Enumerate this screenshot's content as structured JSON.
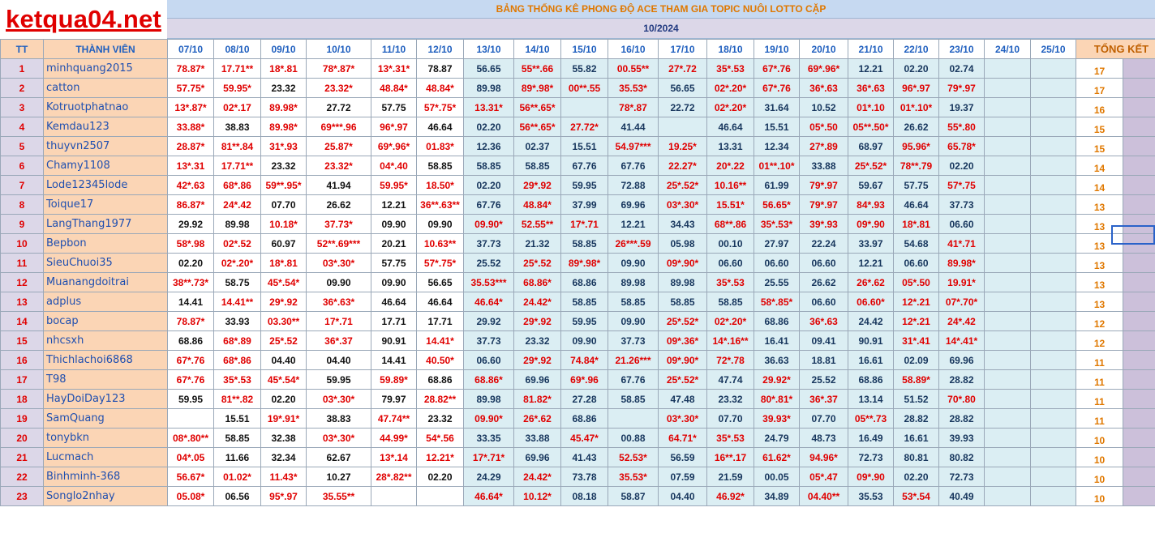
{
  "logo": "ketqua04.net",
  "title": "BẢNG THỐNG KÊ PHONG ĐỘ ACE THAM GIA TOPIC NUÔI LOTTO CẶP",
  "month": "10/2024",
  "colors": {
    "red": "#e00000",
    "header_blue": "#c6d9f1",
    "name_bg": "#fbd5b5",
    "row_num_bg": "#dcd7e8",
    "light_blue": "#dbeef3",
    "summary_orange": "#e07800"
  },
  "headers": {
    "tt": "TT",
    "member": "THÀNH VIÊN",
    "dates": [
      "07/10",
      "08/10",
      "09/10",
      "10/10",
      "11/10",
      "12/10",
      "13/10",
      "14/10",
      "15/10",
      "16/10",
      "17/10",
      "18/10",
      "19/10",
      "20/10",
      "21/10",
      "22/10",
      "23/10",
      "24/10",
      "25/10"
    ],
    "summary": "TỔNG KẾT"
  },
  "rows": [
    {
      "tt": "1",
      "name": "minhquang2015",
      "total": "17",
      "cells": [
        "78.87*",
        "17.71**",
        "18*.81",
        "78*.87*",
        "13*.31*",
        "78.87",
        "56.65",
        "55**.66",
        "55.82",
        "00.55**",
        "27*.72",
        "35*.53",
        "67*.76",
        "69*.96*",
        "12.21",
        "02.20",
        "02.74",
        "",
        ""
      ]
    },
    {
      "tt": "2",
      "name": "catton",
      "total": "17",
      "cells": [
        "57.75*",
        "59.95*",
        "23.32",
        "23.32*",
        "48.84*",
        "48.84*",
        "89.98",
        "89*.98*",
        "00**.55",
        "35.53*",
        "56.65",
        "02*.20*",
        "67*.76",
        "36*.63",
        "36*.63",
        "96*.97",
        "79*.97",
        "",
        ""
      ]
    },
    {
      "tt": "3",
      "name": "Kotruotphatnao",
      "total": "16",
      "cells": [
        "13*.87*",
        "02*.17",
        "89.98*",
        "27.72",
        "57.75",
        "57*.75*",
        "13.31*",
        "56**.65*",
        "",
        "78*.87",
        "22.72",
        "02*.20*",
        "31.64",
        "10.52",
        "01*.10",
        "01*.10*",
        "19.37",
        "",
        ""
      ]
    },
    {
      "tt": "4",
      "name": "Kemdau123",
      "total": "15",
      "cells": [
        "33.88*",
        "38.83",
        "89.98*",
        "69***.96",
        "96*.97",
        "46.64",
        "02.20",
        "56**.65*",
        "27.72*",
        "41.44",
        "",
        "46.64",
        "15.51",
        "05*.50",
        "05**.50*",
        "26.62",
        "55*.80",
        "",
        ""
      ]
    },
    {
      "tt": "5",
      "name": "thuyvn2507",
      "total": "15",
      "cells": [
        "28.87*",
        "81**.84",
        "31*.93",
        "25.87*",
        "69*.96*",
        "01.83*",
        "12.36",
        "02.37",
        "15.51",
        "54.97***",
        "19.25*",
        "13.31",
        "12.34",
        "27*.89",
        "68.97",
        "95.96*",
        "65.78*",
        "",
        ""
      ]
    },
    {
      "tt": "6",
      "name": "Chamy1108",
      "total": "14",
      "cells": [
        "13*.31",
        "17.71**",
        "23.32",
        "23.32*",
        "04*.40",
        "58.85",
        "58.85",
        "58.85",
        "67.76",
        "67.76",
        "22.27*",
        "20*.22",
        "01**.10*",
        "33.88",
        "25*.52*",
        "78**.79",
        "02.20",
        "",
        ""
      ]
    },
    {
      "tt": "7",
      "name": "Lode12345lode",
      "total": "14",
      "cells": [
        "42*.63",
        "68*.86",
        "59**.95*",
        "41.94",
        "59.95*",
        "18.50*",
        "02.20",
        "29*.92",
        "59.95",
        "72.88",
        "25*.52*",
        "10.16**",
        "61.99",
        "79*.97",
        "59.67",
        "57.75",
        "57*.75",
        "",
        ""
      ]
    },
    {
      "tt": "8",
      "name": "Toique17",
      "total": "13",
      "cells": [
        "86.87*",
        "24*.42",
        "07.70",
        "26.62",
        "12.21",
        "36**.63**",
        "67.76",
        "48.84*",
        "37.99",
        "69.96",
        "03*.30*",
        "15.51*",
        "56.65*",
        "79*.97",
        "84*.93",
        "46.64",
        "37.73",
        "",
        ""
      ]
    },
    {
      "tt": "9",
      "name": "LangThang1977",
      "total": "13",
      "cells": [
        "29.92",
        "89.98",
        "10.18*",
        "37.73*",
        "09.90",
        "09.90",
        "09.90*",
        "52.55**",
        "17*.71",
        "12.21",
        "34.43",
        "68**.86",
        "35*.53*",
        "39*.93",
        "09*.90",
        "18*.81",
        "06.60",
        "",
        ""
      ]
    },
    {
      "tt": "10",
      "name": "Bepbon",
      "total": "13",
      "cells": [
        "58*.98",
        "02*.52",
        "60.97",
        "52**.69***",
        "20.21",
        "10.63**",
        "37.73",
        "21.32",
        "58.85",
        "26***.59",
        "05.98",
        "00.10",
        "27.97",
        "22.24",
        "33.97",
        "54.68",
        "41*.71",
        "",
        ""
      ]
    },
    {
      "tt": "11",
      "name": "SieuChuoi35",
      "total": "13",
      "cells": [
        "02.20",
        "02*.20*",
        "18*.81",
        "03*.30*",
        "57.75",
        "57*.75*",
        "25.52",
        "25*.52",
        "89*.98*",
        "09.90",
        "09*.90*",
        "06.60",
        "06.60",
        "06.60",
        "12.21",
        "06.60",
        "89.98*",
        "",
        ""
      ]
    },
    {
      "tt": "12",
      "name": "Muanangdoitrai",
      "total": "13",
      "cells": [
        "38**.73*",
        "58.75",
        "45*.54*",
        "09.90",
        "09.90",
        "56.65",
        "35.53***",
        "68.86*",
        "68.86",
        "89.98",
        "89.98",
        "35*.53",
        "25.55",
        "26.62",
        "26*.62",
        "05*.50",
        "19.91*",
        "",
        ""
      ]
    },
    {
      "tt": "13",
      "name": "adplus",
      "total": "13",
      "cells": [
        "14.41",
        "14.41**",
        "29*.92",
        "36*.63*",
        "46.64",
        "46.64",
        "46.64*",
        "24.42*",
        "58.85",
        "58.85",
        "58.85",
        "58.85",
        "58*.85*",
        "06.60",
        "06.60*",
        "12*.21",
        "07*.70*",
        "",
        ""
      ]
    },
    {
      "tt": "14",
      "name": "bocap",
      "total": "12",
      "cells": [
        "78.87*",
        "33.93",
        "03.30**",
        "17*.71",
        "17.71",
        "17.71",
        "29.92",
        "29*.92",
        "59.95",
        "09.90",
        "25*.52*",
        "02*.20*",
        "68.86",
        "36*.63",
        "24.42",
        "12*.21",
        "24*.42",
        "",
        ""
      ]
    },
    {
      "tt": "15",
      "name": "nhcsxh",
      "total": "12",
      "cells": [
        "68.86",
        "68*.89",
        "25*.52",
        "36*.37",
        "90.91",
        "14.41*",
        "37.73",
        "23.32",
        "09.90",
        "37.73",
        "09*.36*",
        "14*.16**",
        "16.41",
        "09.41",
        "90.91",
        "31*.41",
        "14*.41*",
        "",
        ""
      ]
    },
    {
      "tt": "16",
      "name": "Thichlachoi6868",
      "total": "11",
      "cells": [
        "67*.76",
        "68*.86",
        "04.40",
        "04.40",
        "14.41",
        "40.50*",
        "06.60",
        "29*.92",
        "74.84*",
        "21.26***",
        "09*.90*",
        "72*.78",
        "36.63",
        "18.81",
        "16.61",
        "02.09",
        "69.96",
        "",
        ""
      ]
    },
    {
      "tt": "17",
      "name": "T98",
      "total": "11",
      "cells": [
        "67*.76",
        "35*.53",
        "45*.54*",
        "59.95",
        "59.89*",
        "68.86",
        "68.86*",
        "69.96",
        "69*.96",
        "67.76",
        "25*.52*",
        "47.74",
        "29.92*",
        "25.52",
        "68.86",
        "58.89*",
        "28.82",
        "",
        ""
      ]
    },
    {
      "tt": "18",
      "name": "HayDoiDay123",
      "total": "11",
      "cells": [
        "59.95",
        "81**.82",
        "02.20",
        "03*.30*",
        "79.97",
        "28.82**",
        "89.98",
        "81.82*",
        "27.28",
        "58.85",
        "47.48",
        "23.32",
        "80*.81*",
        "36*.37",
        "13.14",
        "51.52",
        "70*.80",
        "",
        ""
      ]
    },
    {
      "tt": "19",
      "name": "SamQuang",
      "total": "11",
      "cells": [
        "",
        "15.51",
        "19*.91*",
        "38.83",
        "47.74**",
        "23.32",
        "09.90*",
        "26*.62",
        "68.86",
        "",
        "03*.30*",
        "07.70",
        "39.93*",
        "07.70",
        "05**.73",
        "28.82",
        "28.82",
        "",
        ""
      ]
    },
    {
      "tt": "20",
      "name": "tonybkn",
      "total": "10",
      "cells": [
        "08*.80**",
        "58.85",
        "32.38",
        "03*.30*",
        "44.99*",
        "54*.56",
        "33.35",
        "33.88",
        "45.47*",
        "00.88",
        "64.71*",
        "35*.53",
        "24.79",
        "48.73",
        "16.49",
        "16.61",
        "39.93",
        "",
        ""
      ]
    },
    {
      "tt": "21",
      "name": "Lucmach",
      "total": "10",
      "cells": [
        "04*.05",
        "11.66",
        "32.34",
        "62.67",
        "13*.14",
        "12.21*",
        "17*.71*",
        "69.96",
        "41.43",
        "52.53*",
        "56.59",
        "16**.17",
        "61.62*",
        "94.96*",
        "72.73",
        "80.81",
        "80.82",
        "",
        ""
      ]
    },
    {
      "tt": "22",
      "name": "Binhminh-368",
      "total": "10",
      "cells": [
        "56.67*",
        "01.02*",
        "11.43*",
        "10.27",
        "28*.82**",
        "02.20",
        "24.29",
        "24.42*",
        "73.78",
        "35.53*",
        "07.59",
        "21.59",
        "00.05",
        "05*.47",
        "09*.90",
        "02.20",
        "72.73",
        "",
        ""
      ]
    },
    {
      "tt": "23",
      "name": "Songlo2nhay",
      "total": "10",
      "cells": [
        "05.08*",
        "06.56",
        "95*.97",
        "35.55**",
        "",
        "",
        "46.64*",
        "10.12*",
        "08.18",
        "58.87",
        "04.40",
        "46.92*",
        "34.89",
        "04.40**",
        "35.53",
        "53*.54",
        "40.49",
        "",
        ""
      ]
    }
  ]
}
